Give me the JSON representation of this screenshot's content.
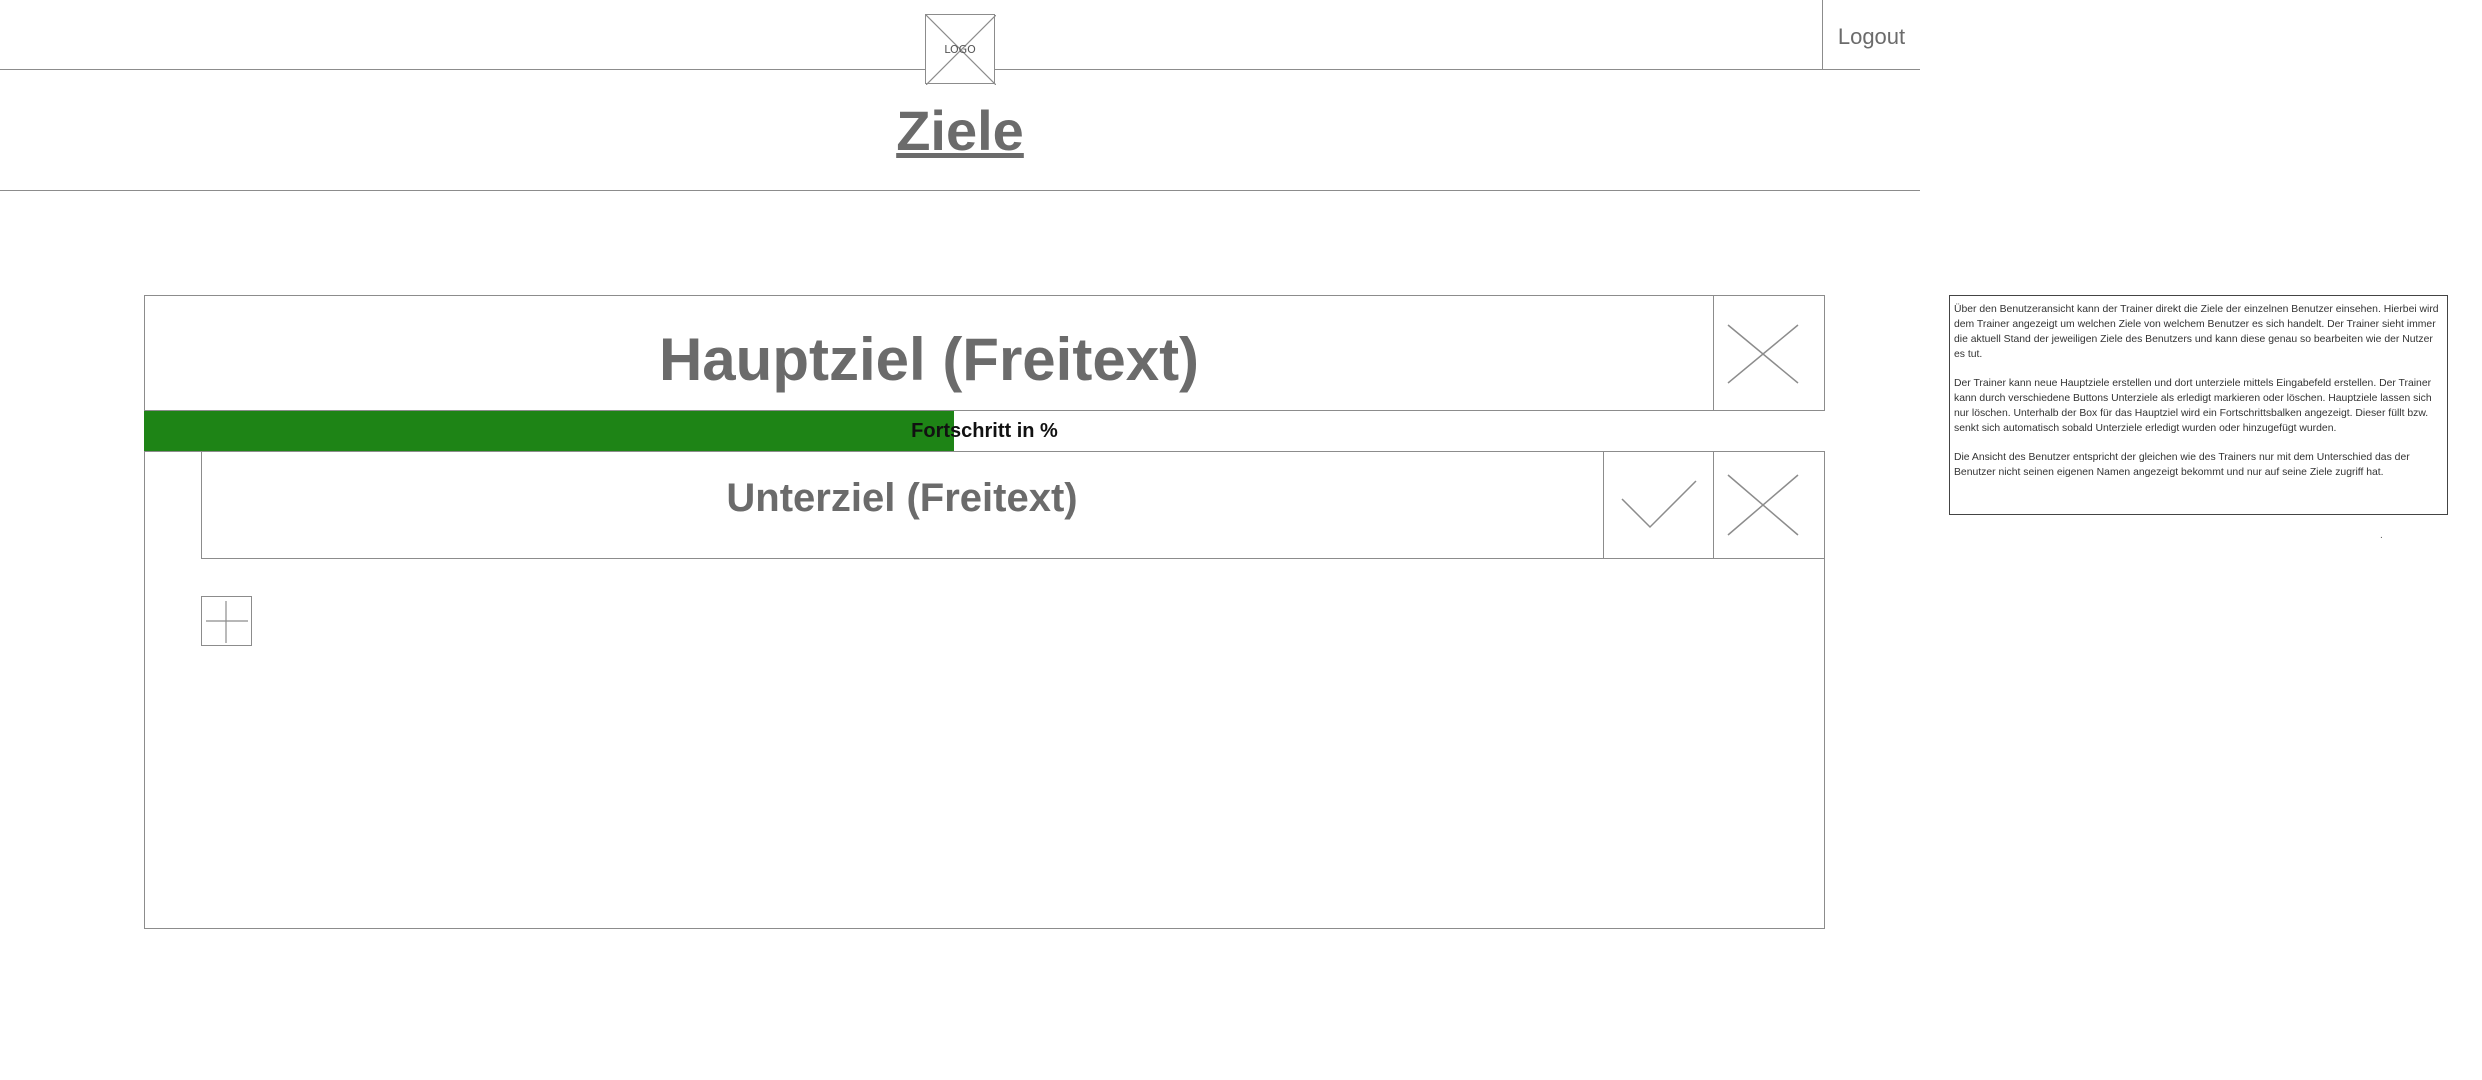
{
  "header": {
    "logo_text": "LOGO",
    "logout_label": "Logout"
  },
  "page": {
    "title": "Ziele"
  },
  "goal": {
    "title": "Hauptziel (Freitext)",
    "progress_label": "Fortschritt in %",
    "progress_fraction": 0.482,
    "progress_color": "#1e8416",
    "subgoals": [
      {
        "title": "Unterziel (Freitext)"
      }
    ]
  },
  "icons": {
    "logo": "placeholder-x-icon",
    "goal_delete": "close-icon",
    "subgoal_done": "check-icon",
    "subgoal_delete": "close-icon",
    "add_subgoal": "plus-icon"
  },
  "note": {
    "paragraph1": "Über den Benutzeransicht kann der Trainer direkt die Ziele der einzelnen Benutzer einsehen. Hierbei wird dem Trainer angezeigt um welchen Ziele von welchem Benutzer es sich handelt. Der Trainer sieht immer die aktuell Stand der jeweiligen Ziele des Benutzers und kann diese genau so bearbeiten wie der Nutzer es tut.",
    "paragraph2": "Der Trainer kann neue Hauptziele erstellen und dort unterziele mittels Eingabefeld erstellen. Der Trainer kann durch verschiedene Buttons Unterziele als erledigt markieren oder löschen. Hauptziele lassen sich nur löschen. Unterhalb der Box für das Hauptziel wird ein Fortschrittsbalken angezeigt. Dieser füllt bzw. senkt sich automatisch sobald Unterziele erledigt wurden oder hinzugefügt wurden.",
    "paragraph3": "Die Ansicht des Benutzer entspricht der gleichen wie des Trainers nur mit dem Unterschied das der Benutzer nicht seinen eigenen Namen angezeigt bekommt und nur auf seine Ziele zugriff hat.",
    "dot": "."
  }
}
